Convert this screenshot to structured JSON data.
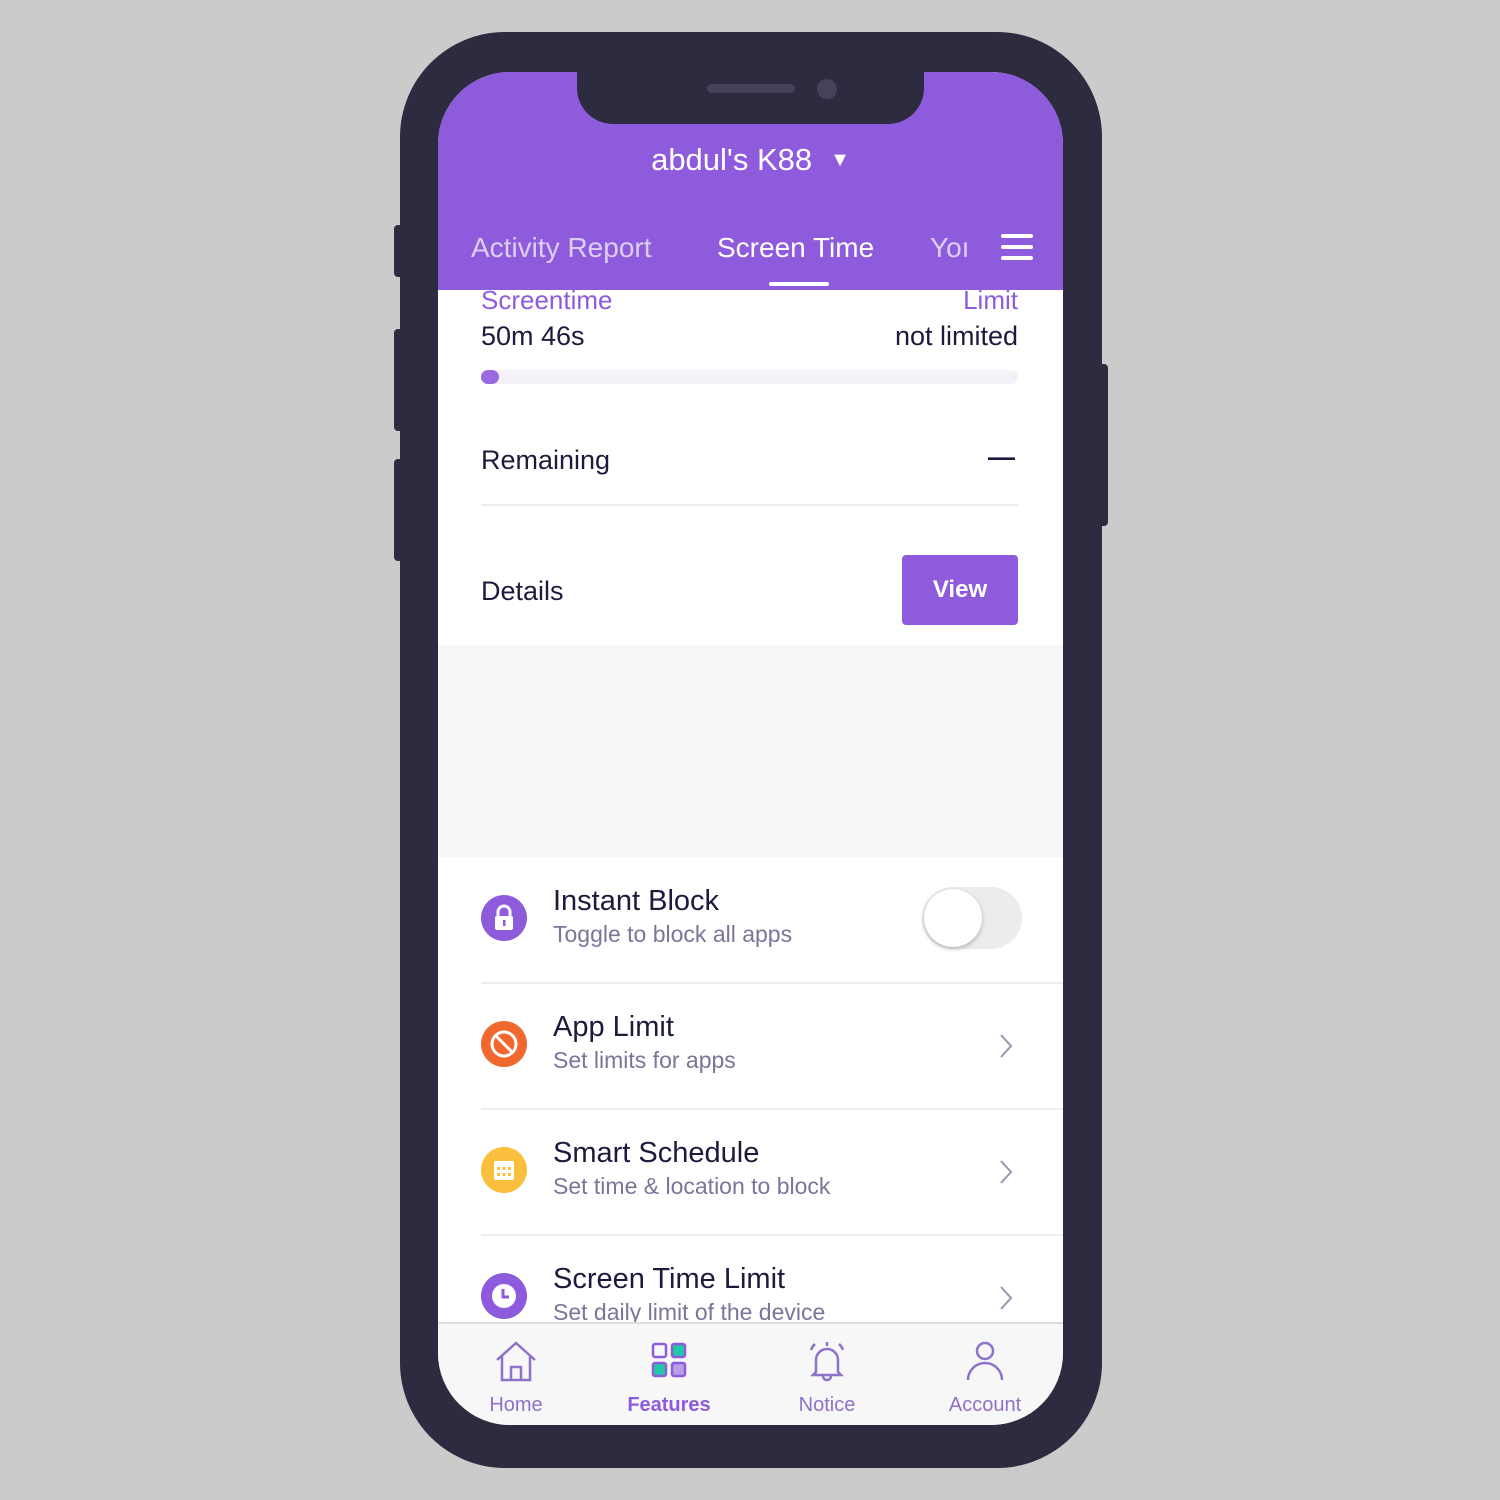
{
  "header": {
    "device_name": "abdul's K88",
    "dropdown_icon": "caret-down-icon"
  },
  "tabs": [
    {
      "label": "Activity Report",
      "active": false
    },
    {
      "label": "Screen Time",
      "active": true
    },
    {
      "label": "Yoı",
      "active": false
    }
  ],
  "summary": {
    "screentime_label": "Screentime",
    "screentime_value": "50m 46s",
    "limit_label": "Limit",
    "limit_value": "not limited",
    "progress_fraction": 0.02,
    "remaining_label": "Remaining",
    "remaining_value": "—",
    "details_label": "Details",
    "view_button": "View"
  },
  "features": [
    {
      "title": "Instant Block",
      "subtitle": "Toggle to block all apps",
      "icon": "lock-icon",
      "color": "#8e5bdc",
      "toggle": false
    },
    {
      "title": "App Limit",
      "subtitle": "Set limits for apps",
      "icon": "block-icon",
      "color": "#f0682e"
    },
    {
      "title": "Smart Schedule",
      "subtitle": "Set time & location to block",
      "icon": "calendar-icon",
      "color": "#fbbf3e"
    },
    {
      "title": "Screen Time Limit",
      "subtitle": "Set daily limit of the device",
      "icon": "clock-icon",
      "color": "#8e5bdc"
    }
  ],
  "bottom_nav": [
    {
      "label": "Home",
      "active": false
    },
    {
      "label": "Features",
      "active": true
    },
    {
      "label": "Notice",
      "active": false
    },
    {
      "label": "Account",
      "active": false
    }
  ],
  "colors": {
    "brand": "#8e5bdc",
    "frame": "#2d2b3f",
    "text": "#1f1a3d"
  }
}
